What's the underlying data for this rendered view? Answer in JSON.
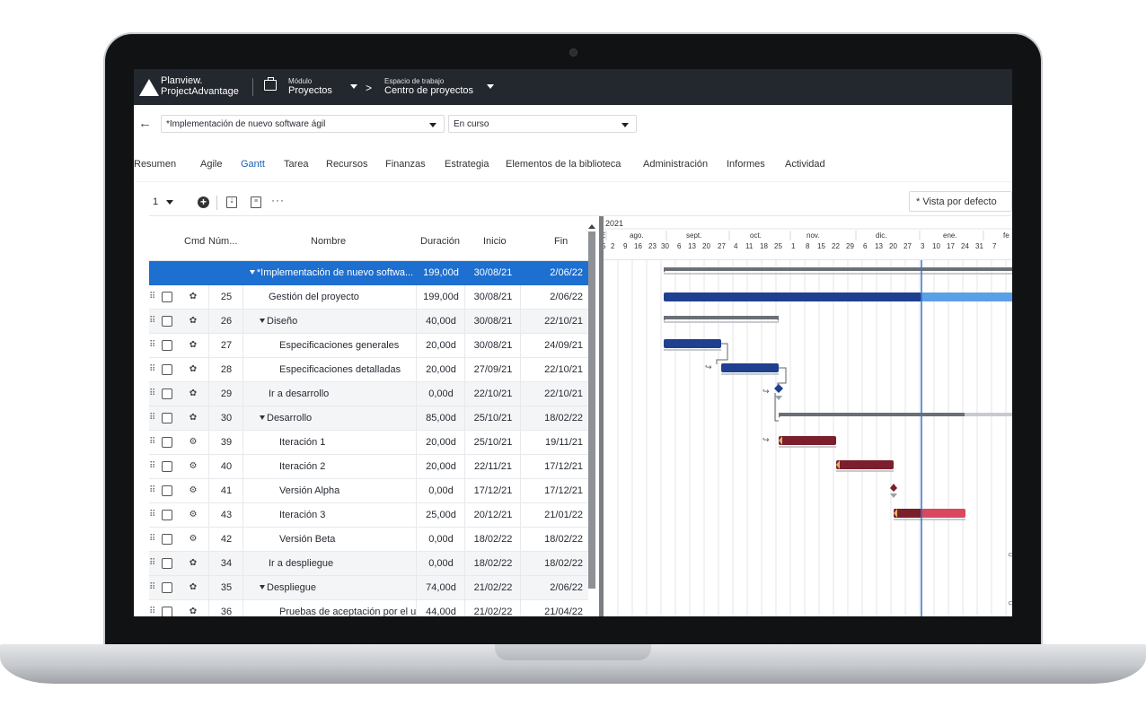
{
  "app": {
    "brand_line1": "Planview.",
    "brand_line2": "ProjectAdvantage",
    "module_label": "Módulo",
    "module_value": "Proyectos",
    "workspace_label": "Espacio de trabajo",
    "workspace_value": "Centro de proyectos"
  },
  "project": {
    "name": "*Implementación de nuevo software ágil",
    "status": "En curso"
  },
  "tabs": [
    "Resumen",
    "Agile",
    "Gantt",
    "Tarea",
    "Recursos",
    "Finanzas",
    "Estrategia",
    "Elementos de la biblioteca",
    "Administración",
    "Informes",
    "Actividad"
  ],
  "active_tab": "Gantt",
  "toolbar": {
    "level": "1",
    "more": "···",
    "view_label": "* Vista por defecto"
  },
  "grid": {
    "headers": {
      "cmd": "Cmd",
      "num": "Núm...",
      "name": "Nombre",
      "duration": "Duración",
      "start": "Inicio",
      "end": "Fin"
    },
    "rows": [
      {
        "num": "",
        "name": "*Implementación de nuevo softwa...",
        "duration": "199,00d",
        "start": "30/08/21",
        "end": "2/06/22"
      },
      {
        "num": "25",
        "name": "Gestión del proyecto",
        "duration": "199,00d",
        "start": "30/08/21",
        "end": "2/06/22"
      },
      {
        "num": "26",
        "name": "Diseño",
        "duration": "40,00d",
        "start": "30/08/21",
        "end": "22/10/21"
      },
      {
        "num": "27",
        "name": "Especificaciones generales",
        "duration": "20,00d",
        "start": "30/08/21",
        "end": "24/09/21"
      },
      {
        "num": "28",
        "name": "Especificaciones detalladas",
        "duration": "20,00d",
        "start": "27/09/21",
        "end": "22/10/21"
      },
      {
        "num": "29",
        "name": "Ir a desarrollo",
        "duration": "0,00d",
        "start": "22/10/21",
        "end": "22/10/21"
      },
      {
        "num": "30",
        "name": "Desarrollo",
        "duration": "85,00d",
        "start": "25/10/21",
        "end": "18/02/22"
      },
      {
        "num": "39",
        "name": "Iteración 1",
        "duration": "20,00d",
        "start": "25/10/21",
        "end": "19/11/21"
      },
      {
        "num": "40",
        "name": "Iteración 2",
        "duration": "20,00d",
        "start": "22/11/21",
        "end": "17/12/21"
      },
      {
        "num": "41",
        "name": "Versión Alpha",
        "duration": "0,00d",
        "start": "17/12/21",
        "end": "17/12/21"
      },
      {
        "num": "43",
        "name": "Iteración 3",
        "duration": "25,00d",
        "start": "20/12/21",
        "end": "21/01/22"
      },
      {
        "num": "42",
        "name": "Versión Beta",
        "duration": "0,00d",
        "start": "18/02/22",
        "end": "18/02/22"
      },
      {
        "num": "34",
        "name": "Ir a despliegue",
        "duration": "0,00d",
        "start": "18/02/22",
        "end": "18/02/22"
      },
      {
        "num": "35",
        "name": "Despliegue",
        "duration": "74,00d",
        "start": "21/02/22",
        "end": "2/06/22"
      },
      {
        "num": "36",
        "name": "Pruebas de aceptación por el u",
        "duration": "44,00d",
        "start": "21/02/22",
        "end": "21/04/22"
      }
    ]
  },
  "timeline": {
    "year": "2021",
    "lead": "E",
    "months": [
      "ago.",
      "sept.",
      "oct.",
      "nov.",
      "dic.",
      "ene.",
      "fe"
    ],
    "weeks": [
      "5",
      "2",
      "9",
      "16",
      "23",
      "30",
      "6",
      "13",
      "20",
      "27",
      "4",
      "11",
      "18",
      "25",
      "1",
      "8",
      "15",
      "22",
      "29",
      "6",
      "13",
      "20",
      "27",
      "3",
      "10",
      "17",
      "24",
      "31",
      "7"
    ]
  },
  "colors": {
    "topbar": "#23272e",
    "selection": "#1d6fd0",
    "bar_blue": "#1f3f8f",
    "bar_blue_light": "#5aa0e8",
    "bar_red": "#7a1f2b",
    "bar_red_light": "#d9485f",
    "summary_bar": "#6b6f76",
    "today_line": "#3f74c9"
  }
}
